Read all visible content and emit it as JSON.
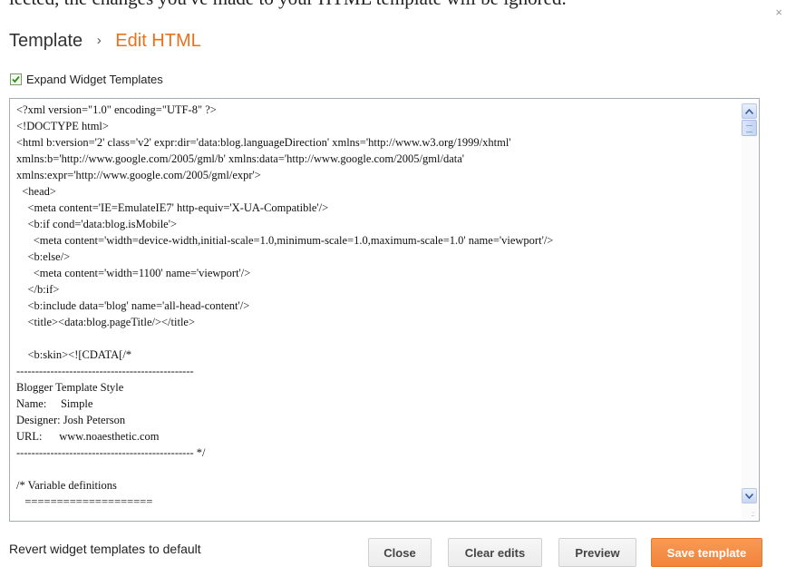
{
  "dialog": {
    "top_text": "lected, the changes you've made to your HTML template will be ignored.",
    "close_glyph": "×"
  },
  "breadcrumb": {
    "root": "Template",
    "separator": "›",
    "current": "Edit HTML"
  },
  "expand_widgets": {
    "label": "Expand Widget Templates",
    "checked": true
  },
  "editor": {
    "lines": [
      "<?xml version=\"1.0\" encoding=\"UTF-8\" ?>",
      "<!DOCTYPE html>",
      "<html b:version='2' class='v2' expr:dir='data:blog.languageDirection' xmlns='http://www.w3.org/1999/xhtml'",
      "xmlns:b='http://www.google.com/2005/gml/b' xmlns:data='http://www.google.com/2005/gml/data'",
      "xmlns:expr='http://www.google.com/2005/gml/expr'>",
      "  <head>",
      "    <meta content='IE=EmulateIE7' http-equiv='X-UA-Compatible'/>",
      "    <b:if cond='data:blog.isMobile'>",
      "      <meta content='width=device-width,initial-scale=1.0,minimum-scale=1.0,maximum-scale=1.0' name='viewport'/>",
      "    <b:else/>",
      "      <meta content='width=1100' name='viewport'/>",
      "    </b:if>",
      "    <b:include data='blog' name='all-head-content'/>",
      "    <title><data:blog.pageTitle/></title>",
      "",
      "    <b:skin><![CDATA[/*",
      "-----------------------------------------------",
      "Blogger Template Style",
      "Name:     Simple",
      "Designer: Josh Peterson",
      "URL:      www.noaesthetic.com",
      "----------------------------------------------- */",
      "",
      "/* Variable definitions",
      "   ===================="
    ]
  },
  "footer": {
    "revert_label": "Revert widget templates to default",
    "close_label": "Close",
    "clear_label": "Clear edits",
    "preview_label": "Preview",
    "save_label": "Save template"
  },
  "colors": {
    "accent_orange": "#e8711c",
    "save_button_bg": "#f3833a"
  }
}
